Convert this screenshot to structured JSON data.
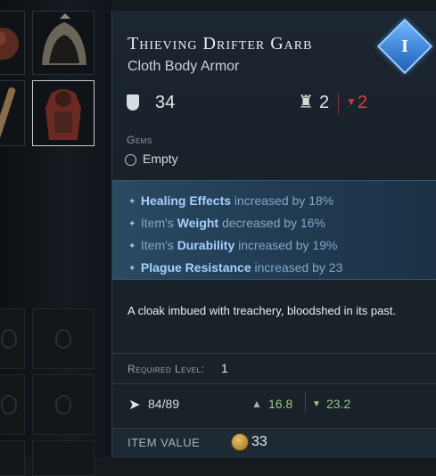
{
  "tooltip": {
    "item_name": "Thieving Drifter Garb",
    "item_type": "Cloth Body Armor",
    "tier": "I",
    "armor": "34",
    "weight_class": "2",
    "damage_modifier": "2",
    "gems_label": "Gems",
    "gem_slot": "Empty",
    "modifiers": [
      {
        "prefix": "",
        "highlight": "Healing Effects",
        "suffix": " increased by 18%"
      },
      {
        "prefix": "Item's ",
        "highlight": "Weight",
        "suffix": " decreased by 16%"
      },
      {
        "prefix": "Item's ",
        "highlight": "Durability",
        "suffix": " increased by 19%"
      },
      {
        "prefix": "",
        "highlight": "Plague Resistance",
        "suffix": " increased by 23"
      }
    ],
    "description": "A cloak imbued with treachery, bloodshed in its past.",
    "required_level_label": "Required Level:",
    "required_level": "1",
    "durability": "84/89",
    "weight": "16.8",
    "protection": "23.2",
    "item_value_label": "ITEM VALUE",
    "item_value": "33"
  },
  "colors": {
    "modifier_highlight": "#a7d0ff",
    "damage_red": "#e23a3f",
    "stat_green": "#9bc58a",
    "tier_blue": "#1f5fb8"
  }
}
